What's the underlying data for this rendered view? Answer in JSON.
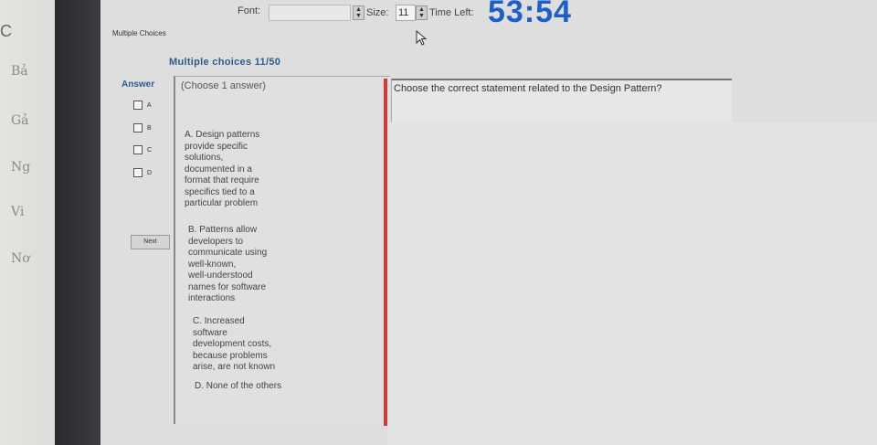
{
  "background_window": {
    "edge_mark": "C",
    "fragments": [
      "Bả",
      "Gả",
      "Ng",
      "Vi",
      "Nơ"
    ]
  },
  "toolbar": {
    "font_label": "Font:",
    "size_label": "Size:",
    "size_value": "11",
    "time_left_label": "Time Left:",
    "timer": "53:54"
  },
  "tab": {
    "label": "Multiple Choices"
  },
  "question_panel": {
    "title": "Multiple choices 11/50",
    "answer_label": "Answer",
    "choices": [
      "A",
      "B",
      "C",
      "D"
    ],
    "next_label": "Next"
  },
  "options": {
    "instruction": "(Choose 1 answer)",
    "items": [
      "A. Design patterns\nprovide specific\nsolutions,\ndocumented in a\nformat that require\nspecifics tied to a\nparticular problem",
      "B. Patterns allow\ndevelopers to\ncommunicate using\nwell-known,\nwell-understood\nnames for software\ninteractions",
      "C. Increased\nsoftware\ndevelopment costs,\nbecause problems\narise, are not known",
      "D. None of the others"
    ]
  },
  "question": {
    "text": "Choose the correct statement related to the Design Pattern?"
  },
  "colors": {
    "timer": "#1e5ec8",
    "title": "#2a5d8f",
    "divider": "#cc3a3a"
  }
}
